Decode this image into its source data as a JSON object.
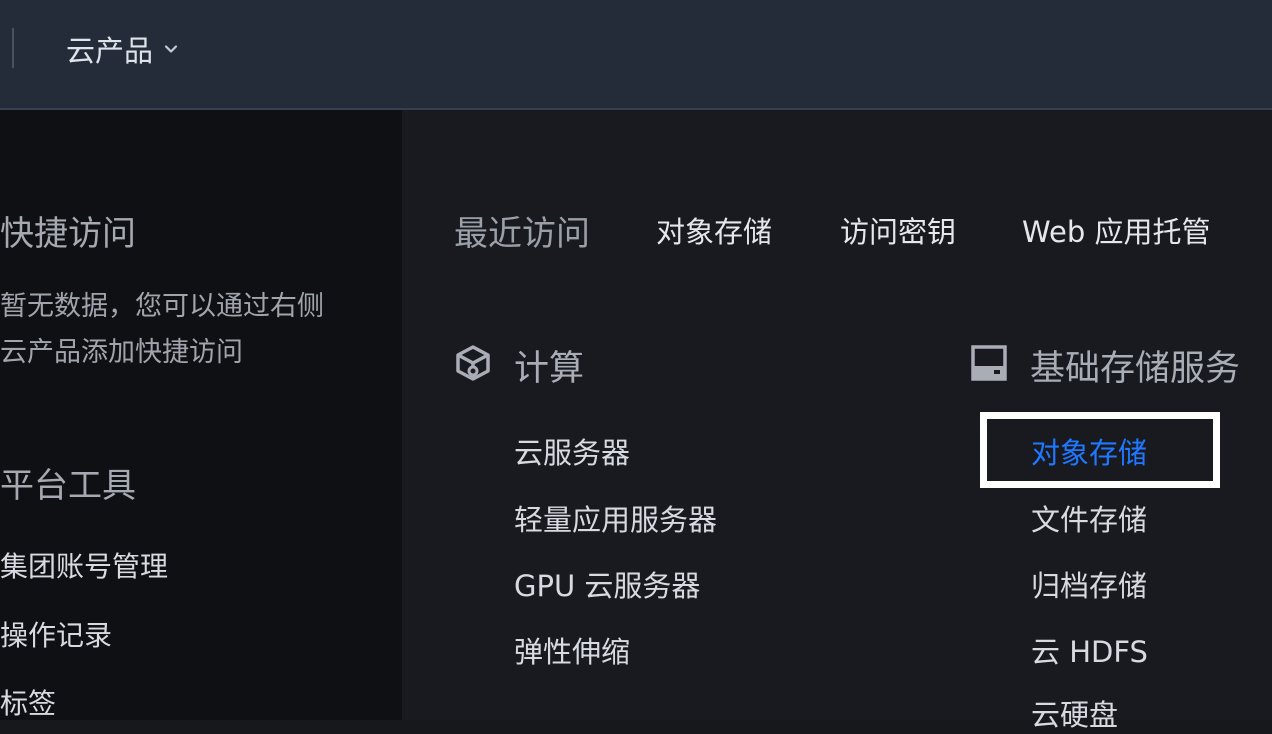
{
  "topbar": {
    "products_label": "云产品"
  },
  "left": {
    "quick_access_title": "快捷访问",
    "empty_message": "暂无数据，您可以通过右侧云产品添加快捷访问",
    "platform_tools_title": "平台工具",
    "tools": [
      "集团账号管理",
      "操作记录",
      "标签"
    ]
  },
  "recent": {
    "label": "最近访问",
    "items": [
      "对象存储",
      "访问密钥",
      "Web 应用托管"
    ]
  },
  "categories": [
    {
      "title": "计算",
      "icon": "compute-cube-icon",
      "items": [
        "云服务器",
        "轻量应用服务器",
        "GPU 云服务器",
        "弹性伸缩"
      ]
    },
    {
      "title": "基础存储服务",
      "icon": "storage-disk-icon",
      "items": [
        "对象存储",
        "文件存储",
        "归档存储",
        "云 HDFS",
        "云硬盘"
      ]
    }
  ],
  "active_item": "对象存储",
  "colors": {
    "accent": "#1f78ff",
    "highlight_box": "#ffffff"
  }
}
